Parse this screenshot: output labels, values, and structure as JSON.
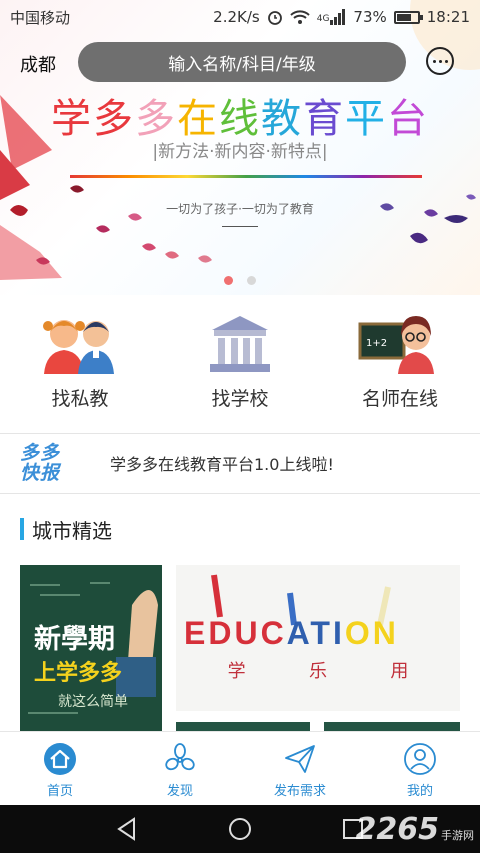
{
  "status_bar": {
    "carrier": "中国移动",
    "speed": "2.2K/s",
    "network": "4G",
    "battery": "73%",
    "battery_level": 0.73,
    "time": "18:21"
  },
  "header": {
    "city": "成都",
    "search_placeholder": "输入名称/科目/年级",
    "message_icon": "chat-bubble-icon"
  },
  "banner": {
    "title": [
      "学",
      "多",
      "多",
      "在",
      "线",
      "教",
      "育",
      "平",
      "台"
    ],
    "title_colors": [
      "#e8383d",
      "#e8383d",
      "#f2a1b8",
      "#f6b400",
      "#5fbf3a",
      "#26a7d9",
      "#6a4bd0",
      "#22b0e6",
      "#c24ad6"
    ],
    "subtitle": "|新方法·新内容·新特点|",
    "slogan": "一切为了孩子·一切为了教育",
    "slide_count": 2,
    "active_slide": 0
  },
  "categories": [
    {
      "label": "找私教",
      "icon": "students-icon"
    },
    {
      "label": "找学校",
      "icon": "school-building-icon"
    },
    {
      "label": "名师在线",
      "icon": "teacher-blackboard-icon"
    }
  ],
  "news": {
    "logo_line1": "多多",
    "logo_line2": "快报",
    "text": "学多多在线教育平台1.0上线啦!"
  },
  "section": {
    "title": "城市精选"
  },
  "cards": {
    "card1_line1": "新學期",
    "card1_line2": "上学多多",
    "card1_line3": "就这么简单",
    "card2_word": "EDUCATION",
    "card2_sub": [
      "学",
      "乐",
      "用"
    ]
  },
  "bottom_nav": [
    {
      "label": "首页",
      "icon": "home-icon",
      "active": true
    },
    {
      "label": "发现",
      "icon": "discover-icon",
      "active": false
    },
    {
      "label": "发布需求",
      "icon": "send-icon",
      "active": false
    },
    {
      "label": "我的",
      "icon": "user-icon",
      "active": false
    }
  ],
  "watermark": {
    "number": "2265",
    "text": "手游网"
  },
  "colors": {
    "accent": "#2a8bd1",
    "section_bar": "#27a6e3",
    "search_bg": "#6f6f6f"
  }
}
